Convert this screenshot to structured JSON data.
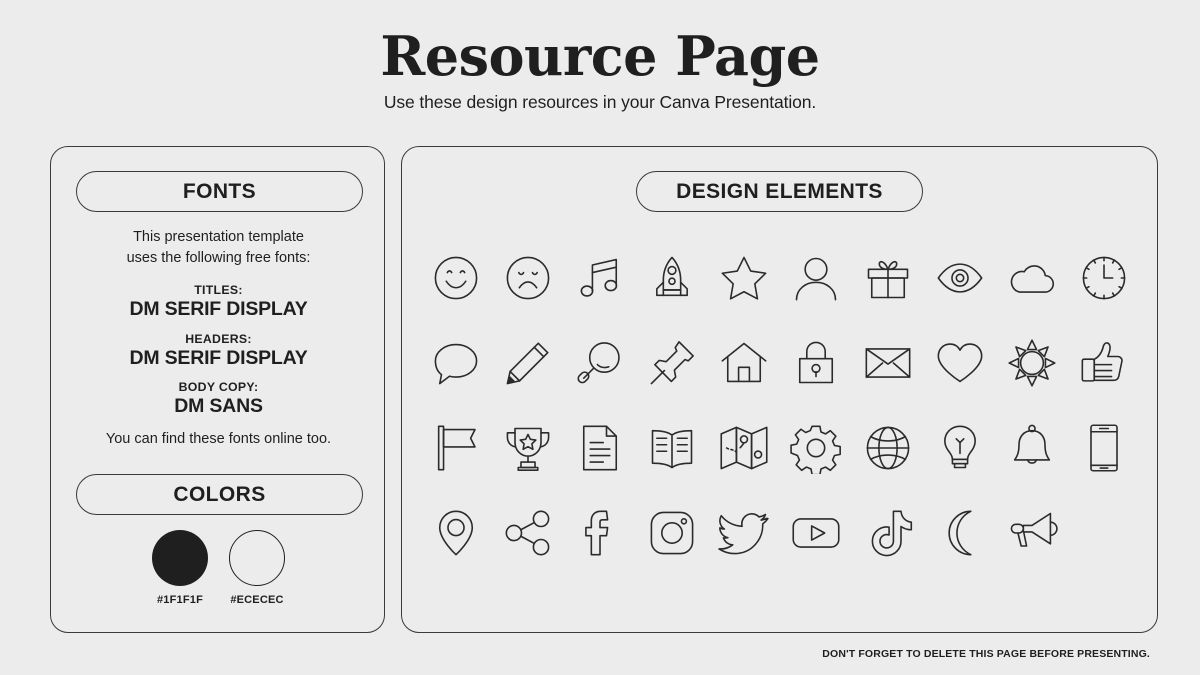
{
  "header": {
    "title": "Resource Page",
    "subtitle": "Use these design resources in your Canva Presentation."
  },
  "fonts_panel": {
    "pill_label": "FONTS",
    "intro": "This presentation template\nuses the following free fonts:",
    "groups": [
      {
        "label": "TITLES:",
        "value": "DM SERIF DISPLAY"
      },
      {
        "label": "HEADERS:",
        "value": "DM SERIF DISPLAY"
      },
      {
        "label": "BODY COPY:",
        "value": "DM SANS"
      }
    ],
    "outro": "You can find these fonts online too."
  },
  "colors_panel": {
    "pill_label": "COLORS",
    "swatches": [
      {
        "name": "dark-swatch",
        "hex": "#1F1F1F",
        "label": "#1F1F1F",
        "style": "dark"
      },
      {
        "name": "light-swatch",
        "hex": "#ECECEC",
        "label": "#ECECEC",
        "style": "light"
      }
    ]
  },
  "design_panel": {
    "pill_label": "DESIGN ELEMENTS",
    "icons": [
      "smiley-face-icon",
      "sad-face-icon",
      "music-note-icon",
      "rocket-icon",
      "star-icon",
      "person-icon",
      "gift-icon",
      "eye-icon",
      "cloud-icon",
      "clock-icon",
      "speech-bubble-icon",
      "pencil-icon",
      "magnifying-glass-icon",
      "pushpin-icon",
      "house-icon",
      "lock-icon",
      "envelope-icon",
      "heart-icon",
      "sun-icon",
      "thumbs-up-icon",
      "flag-icon",
      "trophy-icon",
      "document-icon",
      "book-icon",
      "map-icon",
      "gear-icon",
      "globe-icon",
      "lightbulb-icon",
      "bell-icon",
      "smartphone-icon",
      "location-pin-icon",
      "share-icon",
      "facebook-icon",
      "instagram-icon",
      "twitter-icon",
      "youtube-icon",
      "tiktok-icon",
      "moon-icon",
      "megaphone-icon"
    ]
  },
  "footer": {
    "note": "DON'T FORGET TO DELETE THIS PAGE BEFORE PRESENTING."
  },
  "theme": {
    "background": "#ECECEC",
    "ink": "#1F1F1F",
    "stroke": "#2B2B2B"
  }
}
